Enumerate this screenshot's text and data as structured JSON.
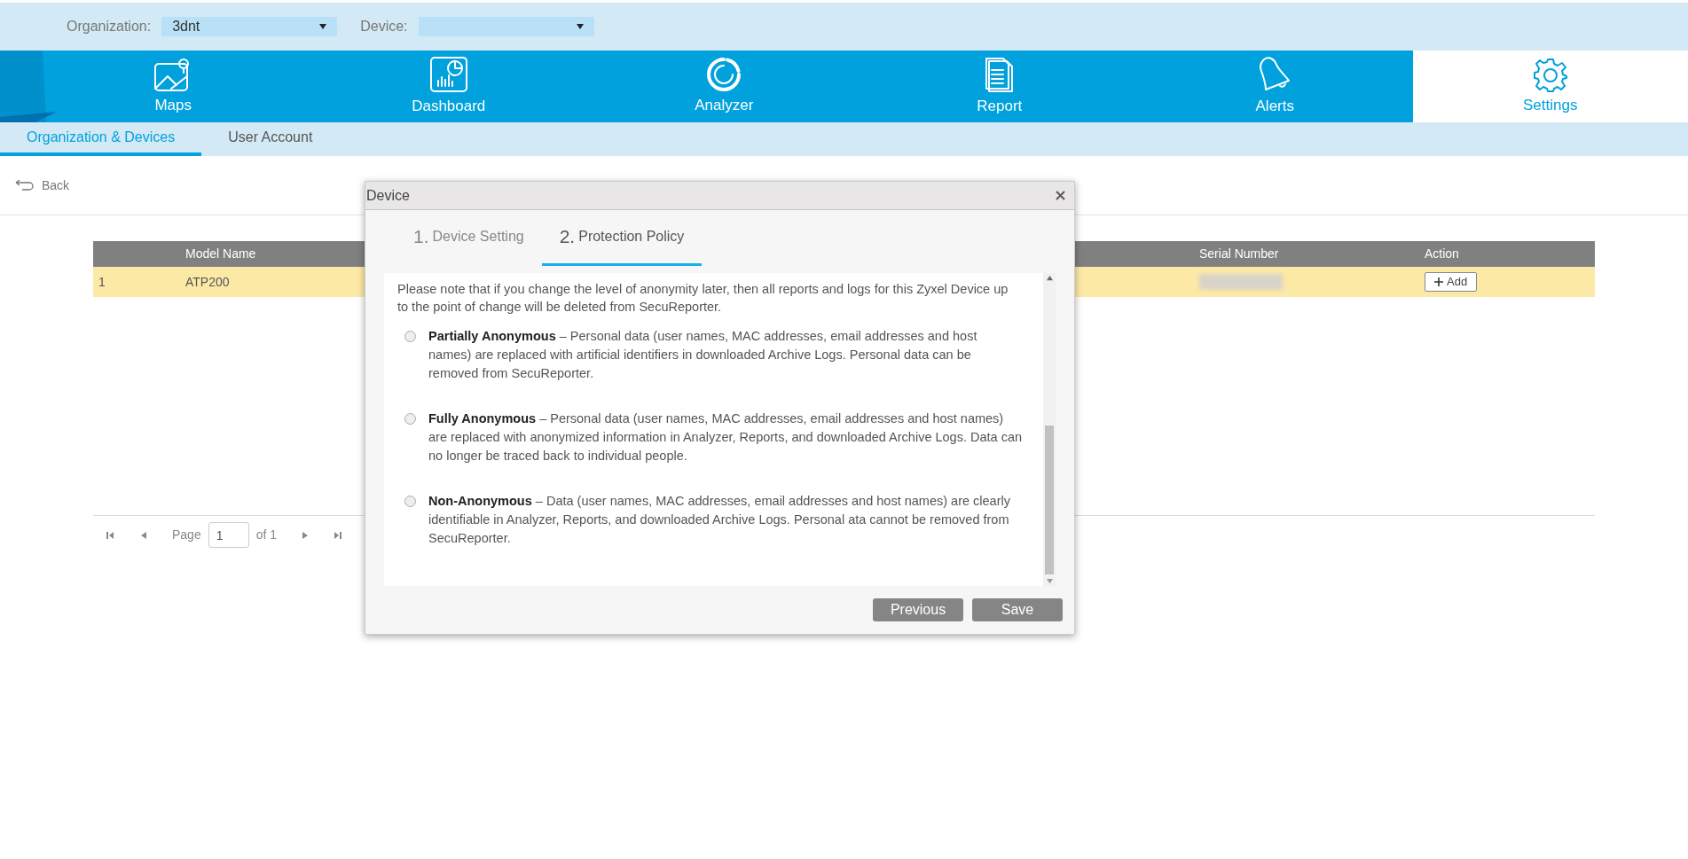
{
  "filters": [
    {
      "label": "Organization:",
      "value": "3dnt"
    },
    {
      "label": "Device:"
    }
  ],
  "nav": [
    {
      "label": "Maps",
      "selected": false
    },
    {
      "label": "Dashboard",
      "selected": false
    },
    {
      "label": "Analyzer",
      "selected": false
    },
    {
      "label": "Report",
      "selected": false
    },
    {
      "label": "Alerts",
      "selected": false
    },
    {
      "label": "Settings",
      "selected": true
    }
  ],
  "subtabs": [
    {
      "label": "Organization & Devices",
      "selected": true
    },
    {
      "label": "User Account",
      "selected": false
    }
  ],
  "back": "Back",
  "table": {
    "columns": [
      "",
      "Model Name",
      "Serial Number",
      "Action"
    ],
    "rows": [
      {
        "index": "1",
        "model": "ATP200",
        "action": "Add"
      }
    ]
  },
  "pagination": {
    "page_label": "Page",
    "page": "1",
    "of": "of 1"
  },
  "dialog": {
    "title": "Device",
    "steps": [
      {
        "number": "1.",
        "label": "Device Setting",
        "selected": false
      },
      {
        "number": "2.",
        "label": "Protection Policy",
        "selected": true
      }
    ],
    "note": "Please note that if you change the level of anonymity later, then all reports and logs for this Zyxel Device up to the point of change will be deleted from SecuReporter.",
    "options": [
      {
        "label": "Partially Anonymous",
        "text": " – Personal data (user names, MAC addresses, email addresses and host names) are replaced with artificial identifiers in downloaded Archive Logs. Personal data can be removed from SecuReporter.",
        "selected": false
      },
      {
        "label": "Fully Anonymous",
        "text": " – Personal data (user names, MAC addresses, email addresses and host names) are replaced with anonymized information in Analyzer, Reports, and downloaded Archive Logs. Data can no longer be traced back to individual people.",
        "selected": false
      },
      {
        "label": "Non-Anonymous",
        "text": " – Data (user names, MAC addresses, email addresses and host names) are clearly identifiable in Analyzer, Reports, and downloaded Archive Logs. Personal ata cannot be removed from SecuReporter.",
        "selected": false
      }
    ],
    "buttons": [
      "Previous",
      "Save"
    ]
  }
}
